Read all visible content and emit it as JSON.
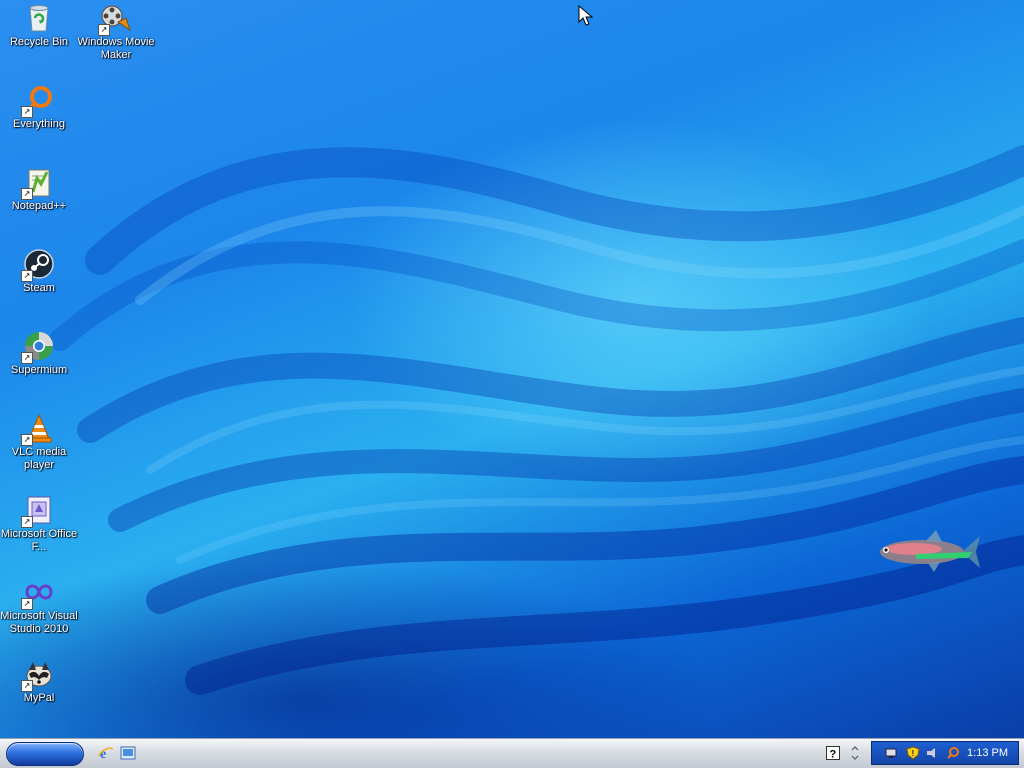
{
  "desktop": {
    "icons": [
      {
        "label": "Recycle Bin",
        "icon": "recycle-bin-icon"
      },
      {
        "label": "Windows Movie Maker",
        "icon": "movie-maker-icon"
      },
      {
        "label": "Everything",
        "icon": "everything-search-icon"
      },
      {
        "label": "Notepad++",
        "icon": "notepad-plus-plus-icon"
      },
      {
        "label": "Steam",
        "icon": "steam-icon"
      },
      {
        "label": "Supermium",
        "icon": "supermium-browser-icon"
      },
      {
        "label": "VLC media player",
        "icon": "vlc-cone-icon"
      },
      {
        "label": "Microsoft Office F...",
        "icon": "office-document-icon"
      },
      {
        "label": "Microsoft Visual Studio 2010",
        "icon": "visual-studio-icon"
      },
      {
        "label": "MyPal",
        "icon": "mypal-browser-icon"
      }
    ]
  },
  "taskbar": {
    "start_label": "",
    "quick_launch": [
      "internet-explorer-icon",
      "show-desktop-icon"
    ],
    "tray_icons": [
      "network-icon",
      "security-shield-icon",
      "volume-icon",
      "everything-search-icon"
    ],
    "clock": "1:13 PM"
  },
  "colors": {
    "taskbar": "#d9dee4",
    "tray": "#1d5fd0",
    "wallpaper": "#1c86ea"
  }
}
